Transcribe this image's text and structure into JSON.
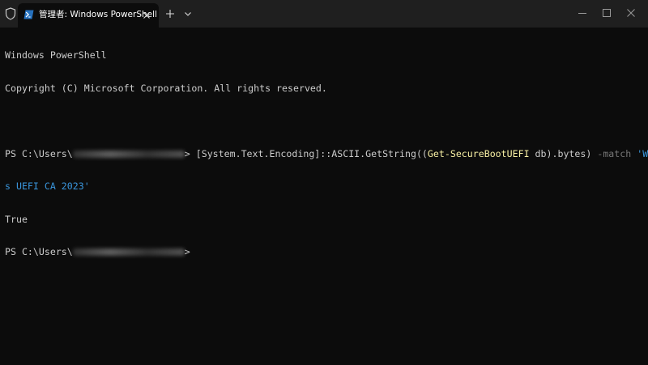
{
  "titlebar": {
    "tab_title": "管理者: Windows PowerShell",
    "icons": {
      "shield": "shield-icon",
      "tab": "powershell-icon",
      "close": "close-icon",
      "new_tab": "plus-icon",
      "dropdown": "chevron-down-icon",
      "minimize": "minimize-icon",
      "maximize": "maximize-icon",
      "window_close": "close-icon"
    }
  },
  "terminal": {
    "header_line1": "Windows PowerShell",
    "header_line2": "Copyright (C) Microsoft Corporation. All rights reserved.",
    "prompt_prefix": "PS C:\\Users\\",
    "prompt_suffix": ">",
    "cmd_part1": " [System.Text.Encoding]::ASCII.GetString((",
    "cmd_cmdlet": "Get-SecureBootUEFI",
    "cmd_arg": " db",
    "cmd_part2": ").bytes) ",
    "cmd_operator": "-match",
    "cmd_space": " ",
    "cmd_string_a": "'Window",
    "cmd_string_b": "s UEFI CA 2023'",
    "output": "True",
    "prompt2_prefix": "PS C:\\Users\\",
    "prompt2_suffix": ">"
  },
  "colors": {
    "background": "#0c0c0c",
    "titlebar": "#1f1f1f",
    "text": "#cccccc",
    "cmdlet": "#f9f1a5",
    "operator": "#767676",
    "string": "#3a96dd"
  }
}
